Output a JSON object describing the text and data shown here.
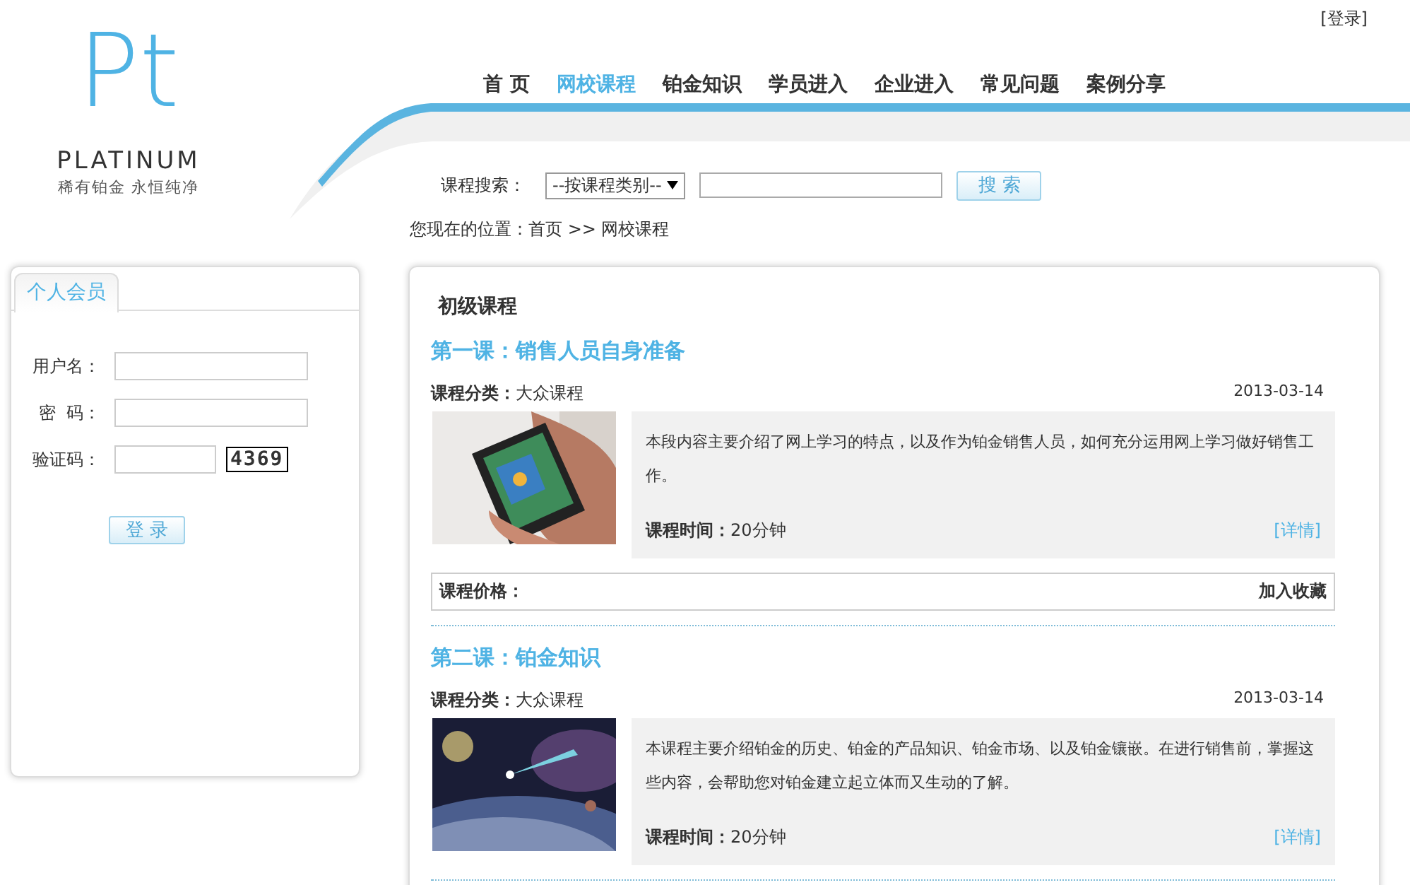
{
  "top_link": "[登录]",
  "logo": {
    "mark": "Pt",
    "name": "PLATINUM",
    "slogan": "稀有铂金 永恒纯净"
  },
  "nav": [
    {
      "label": "首 页",
      "selected": false
    },
    {
      "label": "网校课程",
      "selected": true
    },
    {
      "label": "铂金知识",
      "selected": false
    },
    {
      "label": "学员进入",
      "selected": false
    },
    {
      "label": "企业进入",
      "selected": false
    },
    {
      "label": "常见问题",
      "selected": false
    },
    {
      "label": "案例分享",
      "selected": false
    }
  ],
  "search": {
    "label": "课程搜索：",
    "category": "--按课程类别--",
    "button": "搜 索"
  },
  "breadcrumb": "您现在的位置：首页 >> 网校课程",
  "login": {
    "tab": "个人会员",
    "username_label": "用户名：",
    "password_label": "密  码：",
    "captcha_label": "验证码：",
    "captcha": "4369",
    "button": "登 录"
  },
  "section_title": "初级课程",
  "courses": [
    {
      "title": "第一课：销售人员自身准备",
      "category_label": "课程分类：",
      "category": "大众课程",
      "date": "2013-03-14",
      "description": "本段内容主要介绍了网上学习的特点，以及作为铂金销售人员，如何充分运用网上学习做好销售工作。",
      "time_label": "课程时间：",
      "time": "20分钟",
      "detail": "[详情]",
      "price_label": "课程价格：",
      "favorite": "加入收藏"
    },
    {
      "title": "第二课：铂金知识",
      "category_label": "课程分类：",
      "category": "大众课程",
      "date": "2013-03-14",
      "description": "本课程主要介绍铂金的历史、铂金的产品知识、铂金市场、以及铂金镶嵌。在进行销售前，掌握这些内容，会帮助您对铂金建立起立体而又生动的了解。",
      "time_label": "课程时间：",
      "time": "20分钟",
      "detail": "[详情]"
    }
  ]
}
